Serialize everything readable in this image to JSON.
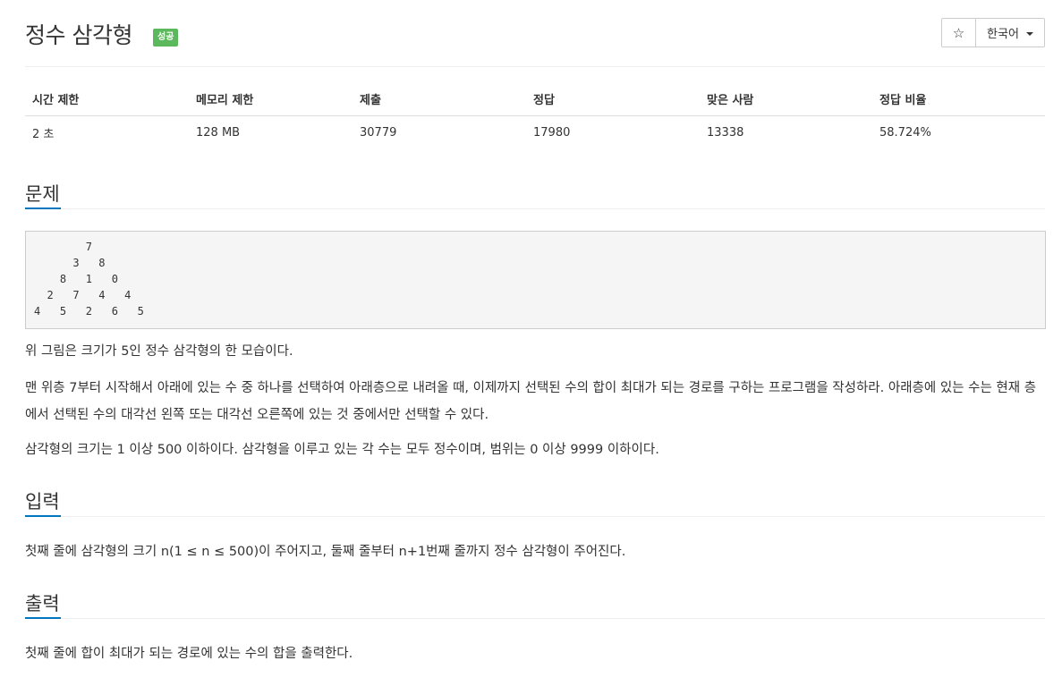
{
  "header": {
    "title": "정수 삼각형",
    "badge": "성공",
    "star_icon": "☆",
    "language": "한국어"
  },
  "stats": {
    "headers": [
      "시간 제한",
      "메모리 제한",
      "제출",
      "정답",
      "맞은 사람",
      "정답 비율"
    ],
    "values": [
      "2 초",
      "128 MB",
      "30779",
      "17980",
      "13338",
      "58.724%"
    ]
  },
  "problem": {
    "heading": "문제",
    "triangle": "        7\n      3   8\n    8   1   0\n  2   7   4   4\n4   5   2   6   5",
    "p1": "위 그림은 크기가 5인 정수 삼각형의 한 모습이다.",
    "p2": "맨 위층 7부터 시작해서 아래에 있는 수 중 하나를 선택하여 아래층으로 내려올 때, 이제까지 선택된 수의 합이 최대가 되는 경로를 구하는 프로그램을 작성하라. 아래층에 있는 수는 현재 층에서 선택된 수의 대각선 왼쪽 또는 대각선 오른쪽에 있는 것 중에서만 선택할 수 있다.",
    "p3": "삼각형의 크기는 1 이상 500 이하이다. 삼각형을 이루고 있는 각 수는 모두 정수이며, 범위는 0 이상 9999 이하이다."
  },
  "input": {
    "heading": "입력",
    "text": "첫째 줄에 삼각형의 크기 n(1 ≤ n ≤ 500)이 주어지고, 둘째 줄부터 n+1번째 줄까지 정수 삼각형이 주어진다."
  },
  "output": {
    "heading": "출력",
    "text": "첫째 줄에 합이 최대가 되는 경로에 있는 수의 합을 출력한다."
  },
  "colors": {
    "accent": "#0076c0",
    "success": "#5cb85c"
  }
}
